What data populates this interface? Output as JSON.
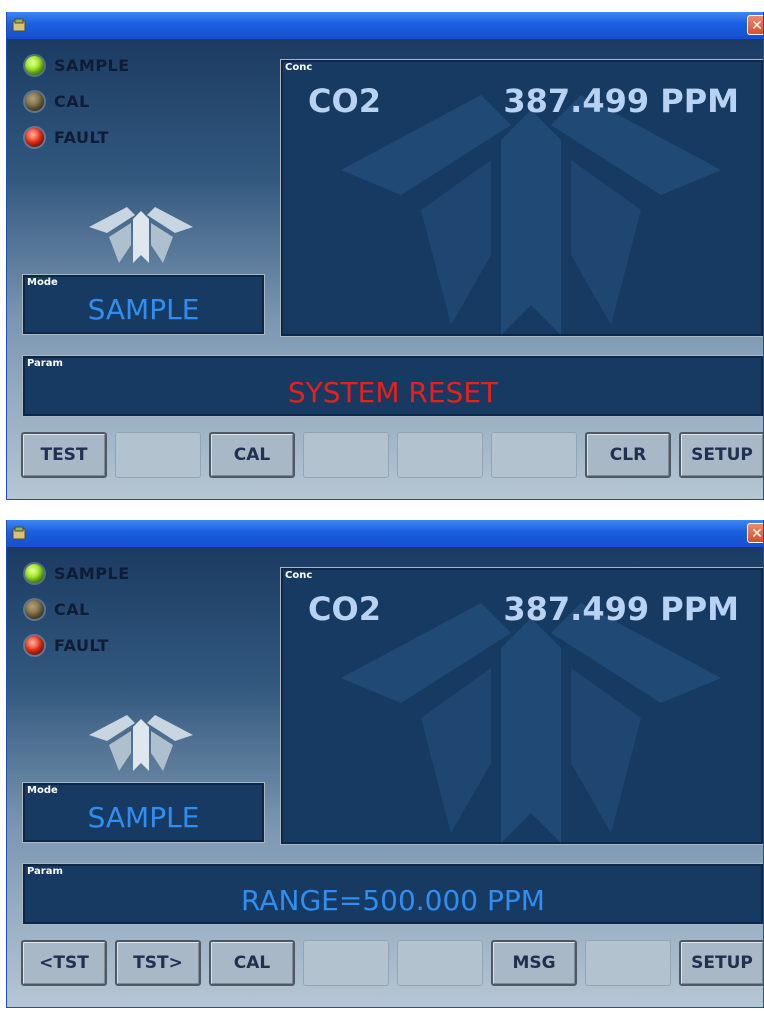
{
  "screens": [
    {
      "leds": [
        {
          "label": "SAMPLE",
          "state": "green"
        },
        {
          "label": "CAL",
          "state": "off"
        },
        {
          "label": "FAULT",
          "state": "red"
        }
      ],
      "mode": {
        "label": "Mode",
        "value": "SAMPLE"
      },
      "conc": {
        "label": "Conc",
        "gas": "CO2",
        "value": "387.499 PPM"
      },
      "param": {
        "label": "Param",
        "value": "SYSTEM RESET",
        "color": "#e8201a"
      },
      "buttons": [
        "TEST",
        "",
        "CAL",
        "",
        "",
        "",
        "CLR",
        "SETUP"
      ]
    },
    {
      "leds": [
        {
          "label": "SAMPLE",
          "state": "green"
        },
        {
          "label": "CAL",
          "state": "off"
        },
        {
          "label": "FAULT",
          "state": "red"
        }
      ],
      "mode": {
        "label": "Mode",
        "value": "SAMPLE"
      },
      "conc": {
        "label": "Conc",
        "gas": "CO2",
        "value": "387.499 PPM"
      },
      "param": {
        "label": "Param",
        "value": "RANGE=500.000 PPM",
        "color": "#2f8ef0"
      },
      "buttons": [
        "<TST",
        "TST>",
        "CAL",
        "",
        "",
        "MSG",
        "",
        "SETUP"
      ]
    }
  ],
  "icons": {
    "close": "close-icon",
    "app": "app-icon",
    "logo": "teledyne-logo-icon"
  },
  "colors": {
    "titlebar": "#1a5fe0",
    "panel": "#173a62",
    "mode_text": "#2f8ef0",
    "fault_text": "#e8201a"
  }
}
